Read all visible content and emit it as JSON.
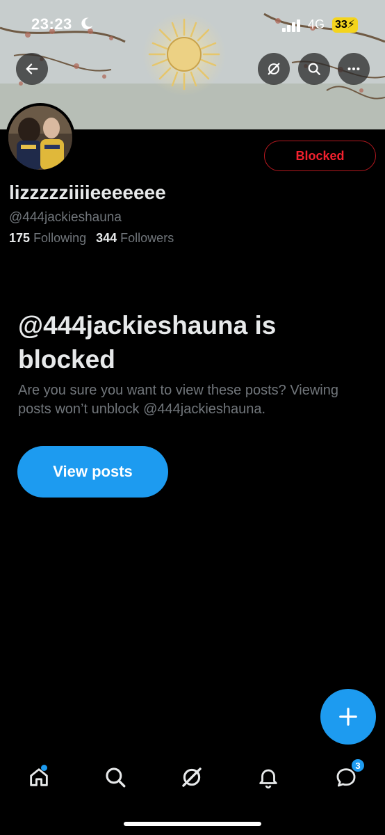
{
  "status_bar": {
    "time": "23:23",
    "network": "4G",
    "battery": "33"
  },
  "profile": {
    "display_name": "lizzzzziiiieeeeeee",
    "handle": "@444jackieshauna",
    "following_count": "175",
    "following_label": "Following",
    "followers_count": "344",
    "followers_label": "Followers",
    "blocked_button_label": "Blocked"
  },
  "blocked_notice": {
    "title": "@444jackieshauna is blocked",
    "description": "Are you sure you want to view these posts? Viewing posts won’t unblock @444jackieshauna.",
    "view_posts_label": "View posts"
  },
  "bottom_nav": {
    "messages_badge": "3"
  },
  "icons": {
    "top_bar": [
      "back-arrow-icon",
      "grok-icon",
      "search-icon",
      "more-icon"
    ],
    "nav": [
      "home-icon",
      "search-icon",
      "grok-icon",
      "notifications-bell-icon",
      "messages-icon"
    ],
    "fab": "plus-icon"
  },
  "colors": {
    "accent": "#1d9bf0",
    "blocked_red": "#f4212e",
    "background": "#000000",
    "primary_text": "#e7e9ea",
    "secondary_text": "#71767b"
  }
}
